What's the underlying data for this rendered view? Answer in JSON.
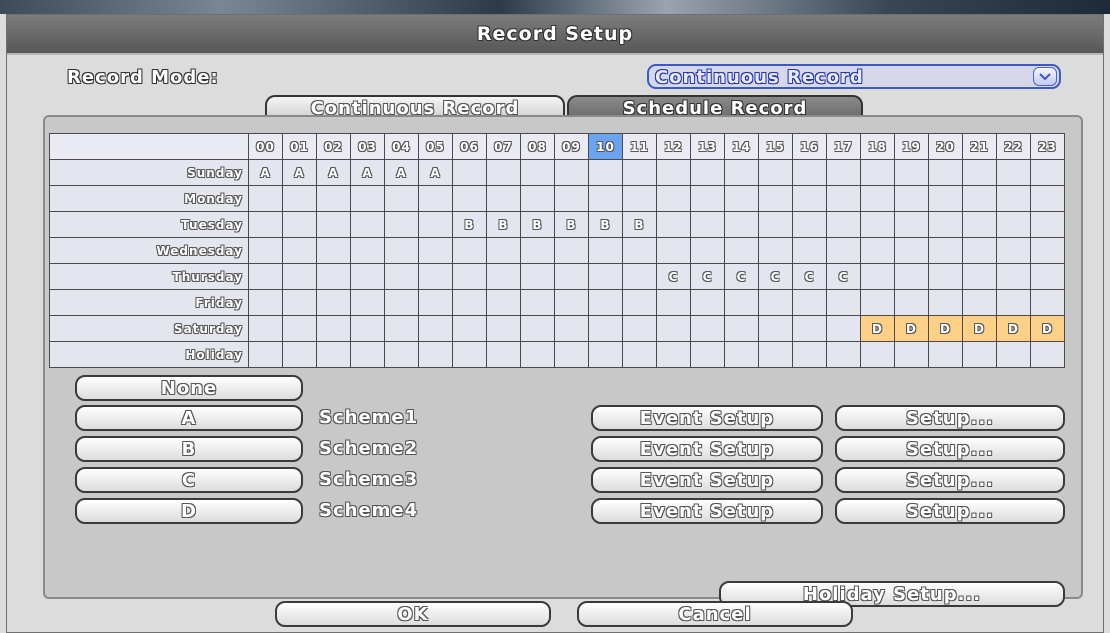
{
  "window": {
    "title": "Record Setup"
  },
  "record_mode": {
    "label": "Record Mode:",
    "selected": "Continuous Record",
    "dropdown_icon": "chevron-down-icon"
  },
  "tabs": [
    {
      "label": "Continuous Record",
      "active": false
    },
    {
      "label": "Schedule Record",
      "active": true
    }
  ],
  "schedule": {
    "hours": [
      "00",
      "01",
      "02",
      "03",
      "04",
      "05",
      "06",
      "07",
      "08",
      "09",
      "10",
      "11",
      "12",
      "13",
      "14",
      "15",
      "16",
      "17",
      "18",
      "19",
      "20",
      "21",
      "22",
      "23"
    ],
    "selected_hour": "10",
    "days": [
      {
        "name": "Sunday",
        "cells": [
          "A",
          "A",
          "A",
          "A",
          "A",
          "A",
          "",
          "",
          "",
          "",
          "",
          "",
          "",
          "",
          "",
          "",
          "",
          "",
          "",
          "",
          "",
          "",
          "",
          ""
        ]
      },
      {
        "name": "Monday",
        "cells": [
          "",
          "",
          "",
          "",
          "",
          "",
          "",
          "",
          "",
          "",
          "",
          "",
          "",
          "",
          "",
          "",
          "",
          "",
          "",
          "",
          "",
          "",
          "",
          ""
        ]
      },
      {
        "name": "Tuesday",
        "cells": [
          "",
          "",
          "",
          "",
          "",
          "",
          "B",
          "B",
          "B",
          "B",
          "B",
          "B",
          "",
          "",
          "",
          "",
          "",
          "",
          "",
          "",
          "",
          "",
          "",
          ""
        ]
      },
      {
        "name": "Wednesday",
        "cells": [
          "",
          "",
          "",
          "",
          "",
          "",
          "",
          "",
          "",
          "",
          "",
          "",
          "",
          "",
          "",
          "",
          "",
          "",
          "",
          "",
          "",
          "",
          "",
          ""
        ]
      },
      {
        "name": "Thursday",
        "cells": [
          "",
          "",
          "",
          "",
          "",
          "",
          "",
          "",
          "",
          "",
          "",
          "",
          "C",
          "C",
          "C",
          "C",
          "C",
          "C",
          "",
          "",
          "",
          "",
          "",
          ""
        ]
      },
      {
        "name": "Friday",
        "cells": [
          "",
          "",
          "",
          "",
          "",
          "",
          "",
          "",
          "",
          "",
          "",
          "",
          "",
          "",
          "",
          "",
          "",
          "",
          "",
          "",
          "",
          "",
          "",
          ""
        ]
      },
      {
        "name": "Saturday",
        "cells": [
          "",
          "",
          "",
          "",
          "",
          "",
          "",
          "",
          "",
          "",
          "",
          "",
          "",
          "",
          "",
          "",
          "",
          "",
          "D",
          "D",
          "D",
          "D",
          "D",
          "D"
        ]
      },
      {
        "name": "Holiday",
        "cells": [
          "",
          "",
          "",
          "",
          "",
          "",
          "",
          "",
          "",
          "",
          "",
          "",
          "",
          "",
          "",
          "",
          "",
          "",
          "",
          "",
          "",
          "",
          "",
          ""
        ]
      }
    ]
  },
  "schemes": {
    "none_label": "None",
    "items": [
      {
        "key": "A",
        "name": "Scheme1",
        "event_label": "Event Setup",
        "setup_label": "Setup..."
      },
      {
        "key": "B",
        "name": "Scheme2",
        "event_label": "Event Setup",
        "setup_label": "Setup..."
      },
      {
        "key": "C",
        "name": "Scheme3",
        "event_label": "Event Setup",
        "setup_label": "Setup..."
      },
      {
        "key": "D",
        "name": "Scheme4",
        "event_label": "Event Setup",
        "setup_label": "Setup..."
      }
    ]
  },
  "holiday_setup_label": "Holiday Setup...",
  "footer": {
    "ok_label": "OK",
    "cancel_label": "Cancel"
  },
  "colors": {
    "selected_hour": "#6aa3f0",
    "scheme_d": "#fcd087",
    "accent_blue": "#3b59c9"
  }
}
